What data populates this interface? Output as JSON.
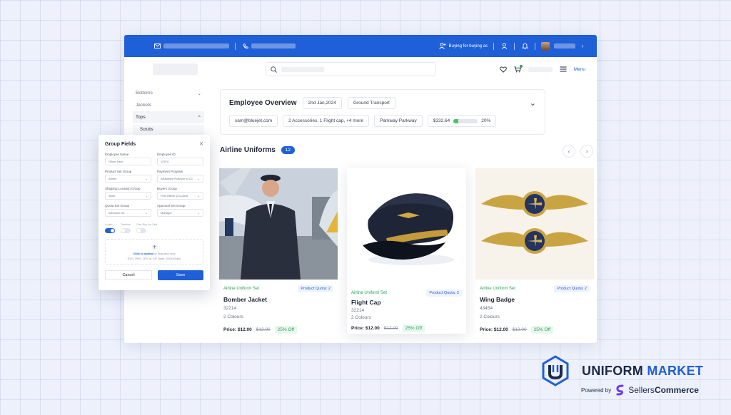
{
  "topbar": {
    "buying_for": "Buying for buying as"
  },
  "header": {
    "menu_label": "Menu"
  },
  "sidebar": {
    "items": [
      {
        "label": "Bottoms"
      },
      {
        "label": "Jackets"
      },
      {
        "label": "Tops"
      }
    ],
    "sub_item": "Scrubs"
  },
  "overview": {
    "title": "Employee Overview",
    "date": "2nd Jan,2024",
    "transport": "Ground Transport",
    "email": "sam@bluejet.com",
    "accessories": "2 Accessories, 1 Flight cap, +4 more",
    "location": "Parkway Parkway",
    "amount": "$332.64",
    "progress_pct": 20,
    "progress_label": "20%"
  },
  "section": {
    "title": "Airline Uniforms",
    "count": "12"
  },
  "products": [
    {
      "set": "Airline Uniform Set",
      "quota": "Product Quota: 2",
      "name": "Bomber Jacket",
      "code": "32214",
      "colours": "2 Colours",
      "price": "Price: $12.00",
      "old_price": "$12.00",
      "off": "25% Off"
    },
    {
      "set": "Airline Uniform Set",
      "quota": "Product Quota: 2",
      "name": "Flight Cap",
      "code": "32214",
      "colours": "2 Colours",
      "price": "Price: $12.00",
      "old_price": "$12.00",
      "off": "25% Off"
    },
    {
      "set": "Airline Uniform Set",
      "quota": "Product Quota: 2",
      "name": "Wing Badge",
      "code": "43454",
      "colours": "2 Colours",
      "price": "Price: $12.00",
      "old_price": "$12.00",
      "off": "25% Off"
    }
  ],
  "modal": {
    "title": "Group Fields",
    "fields": [
      {
        "label": "Employee Name",
        "value": "Oliver Sam"
      },
      {
        "label": "Employee ID",
        "value": "12974"
      },
      {
        "label": "Product Set Group",
        "value": "Admin"
      },
      {
        "label": "Payment Program",
        "value": "Allowance Rollover to CC"
      },
      {
        "label": "Shipping Location Group",
        "value": "Work"
      },
      {
        "label": "Buyers Group",
        "value": "First Officer (Co-pilot)"
      },
      {
        "label": "Quota Set Group",
        "value": "Welcome Kit"
      },
      {
        "label": "Approval Set Group",
        "value": "Manager"
      }
    ],
    "toggles": [
      {
        "label": "Login",
        "on": true
      },
      {
        "label": "Taxable",
        "on": false
      },
      {
        "label": "Can Buy for Self",
        "on": false
      }
    ],
    "upload_link": "Click to upload",
    "upload_text": "or drag and drop",
    "upload_hint": "SVG, PNG, JPG or GIF (max. 800x400px)",
    "cancel_label": "Cancel",
    "save_label": "Save"
  },
  "brand": {
    "name_part1": "UNIFORM",
    "name_part2": "MARKET",
    "powered_by": "Powered by",
    "partner_part1": "Sellers",
    "partner_part2": "Commerce"
  },
  "colors": {
    "accent": "#1f5fd8",
    "success": "#2ea05a",
    "progress": "#4cc46a"
  }
}
